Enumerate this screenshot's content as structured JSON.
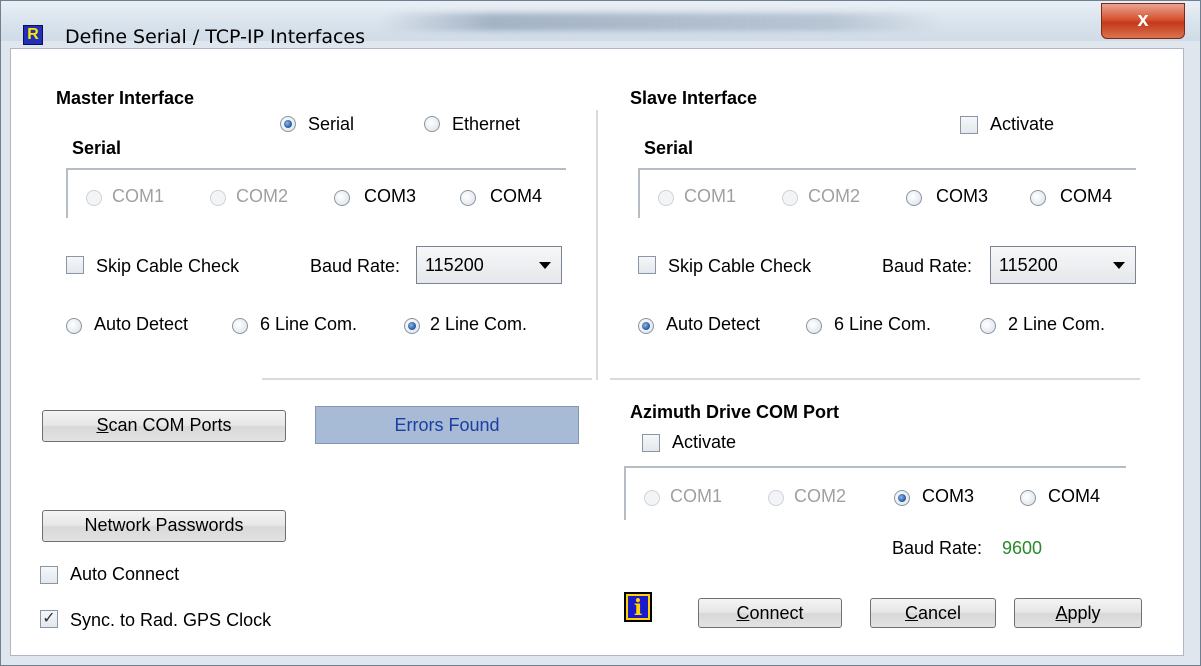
{
  "window": {
    "title": "Define Serial / TCP-IP Interfaces",
    "app_icon_glyph": "R",
    "close_glyph": "x"
  },
  "master": {
    "heading": "Master Interface",
    "type_options": [
      "Serial",
      "Ethernet"
    ],
    "type_selected": "Serial",
    "serial_heading": "Serial",
    "com_ports": [
      {
        "label": "COM1",
        "enabled": false,
        "selected": false
      },
      {
        "label": "COM2",
        "enabled": false,
        "selected": false
      },
      {
        "label": "COM3",
        "enabled": true,
        "selected": false
      },
      {
        "label": "COM4",
        "enabled": true,
        "selected": false
      }
    ],
    "skip_cable_check": {
      "label": "Skip Cable Check",
      "checked": false
    },
    "baud_rate_label": "Baud Rate:",
    "baud_rate_value": "115200",
    "line_modes": [
      {
        "label": "Auto Detect",
        "selected": false
      },
      {
        "label": "6 Line Com.",
        "selected": false
      },
      {
        "label": "2 Line Com.",
        "selected": true
      }
    ]
  },
  "slave": {
    "heading": "Slave Interface",
    "activate": {
      "label": "Activate",
      "checked": false
    },
    "serial_heading": "Serial",
    "com_ports": [
      {
        "label": "COM1",
        "enabled": false,
        "selected": false
      },
      {
        "label": "COM2",
        "enabled": false,
        "selected": false
      },
      {
        "label": "COM3",
        "enabled": true,
        "selected": false
      },
      {
        "label": "COM4",
        "enabled": true,
        "selected": false
      }
    ],
    "skip_cable_check": {
      "label": "Skip Cable Check",
      "checked": false
    },
    "baud_rate_label": "Baud Rate:",
    "baud_rate_value": "115200",
    "line_modes": [
      {
        "label": "Auto Detect",
        "selected": true
      },
      {
        "label": "6 Line Com.",
        "selected": false
      },
      {
        "label": "2 Line Com.",
        "selected": false
      }
    ]
  },
  "actions": {
    "scan_com_ports": {
      "prefix": "",
      "underlined": "S",
      "rest": "can COM Ports"
    },
    "errors_status": "Errors Found",
    "network_passwords": "Network Passwords",
    "auto_connect": {
      "label": "Auto Connect",
      "checked": false
    },
    "sync_gps": {
      "label": "Sync. to Rad. GPS Clock",
      "checked": true
    }
  },
  "azimuth": {
    "heading": "Azimuth Drive COM Port",
    "activate": {
      "label": "Activate",
      "checked": false
    },
    "com_ports": [
      {
        "label": "COM1",
        "enabled": false,
        "selected": false
      },
      {
        "label": "COM2",
        "enabled": false,
        "selected": false
      },
      {
        "label": "COM3",
        "enabled": true,
        "selected": true
      },
      {
        "label": "COM4",
        "enabled": true,
        "selected": false
      }
    ],
    "baud_rate_label": "Baud Rate:",
    "baud_rate_value": "9600",
    "baud_rate_value_color": "#2a8a2a"
  },
  "footer": {
    "info_glyph": "i",
    "connect": {
      "underlined": "C",
      "rest": "onnect"
    },
    "cancel": {
      "underlined": "C",
      "rest": "ancel"
    },
    "apply": {
      "underlined": "A",
      "rest": "pply"
    }
  },
  "colors": {
    "errors_bg": "#a7bbd6",
    "errors_text": "#1b3ea0",
    "close_red": "#c4391a",
    "info_blue": "#1a1acc",
    "info_yellow": "#ffd200"
  }
}
